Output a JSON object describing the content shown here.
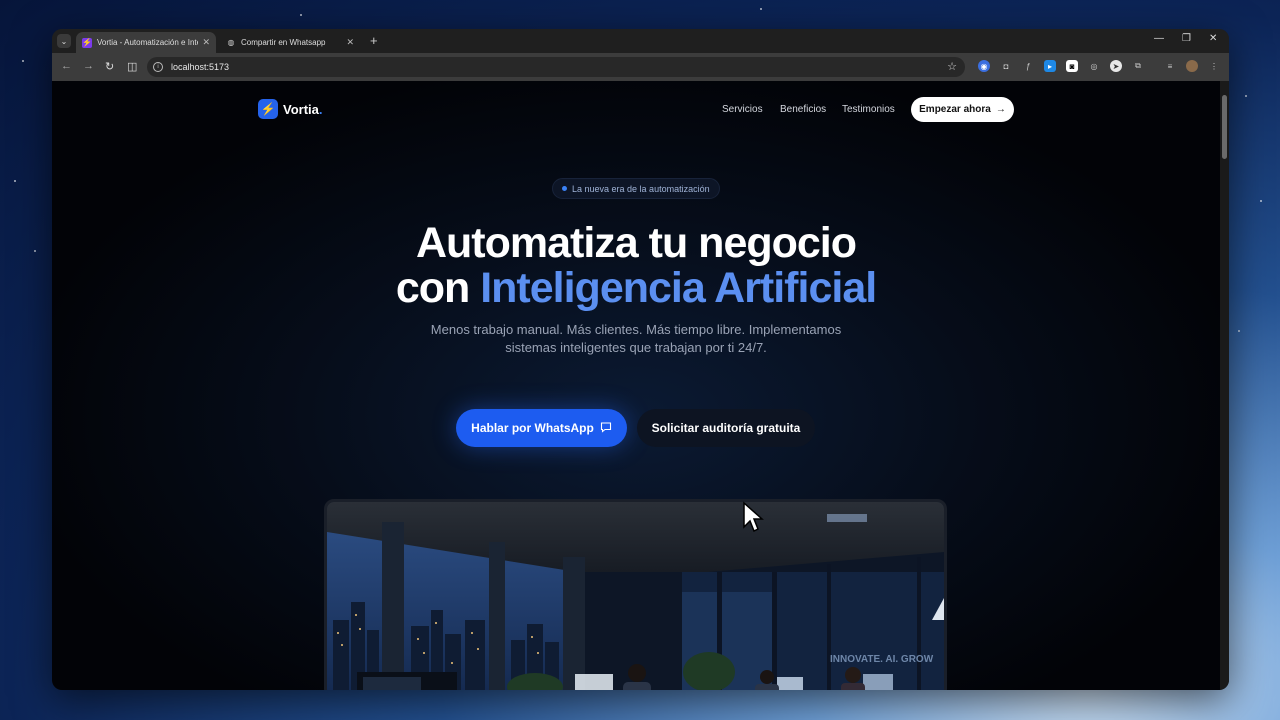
{
  "browser": {
    "tabs": [
      {
        "title": "Vortia - Automatización e Intel",
        "active": true
      },
      {
        "title": "Compartir en Whatsapp",
        "active": false
      }
    ],
    "url": "localhost:5173"
  },
  "site": {
    "brand": "Vortia",
    "brand_dot": ".",
    "nav": [
      "Servicios",
      "Beneficios",
      "Testimonios"
    ],
    "nav_cta": "Empezar ahora",
    "badge": "La nueva era de la automatización",
    "headline_line1": "Automatiza tu negocio",
    "headline_line2_prefix": "con",
    "headline_line2_accent": "Inteligencia Artificial",
    "subtitle_line1": "Menos trabajo manual. Más clientes. Más tiempo libre. Implementamos",
    "subtitle_line2": "sistemas inteligentes que trabajan por ti 24/7.",
    "primary_button": "Hablar por WhatsApp",
    "secondary_button": "Solicitar auditoría gratuita",
    "hero_image_wall_text": "INNOVATE. AI. GROW"
  },
  "colors": {
    "accent": "#3b82f6",
    "primary_button": "#1d5cf0",
    "background": "#020307"
  }
}
